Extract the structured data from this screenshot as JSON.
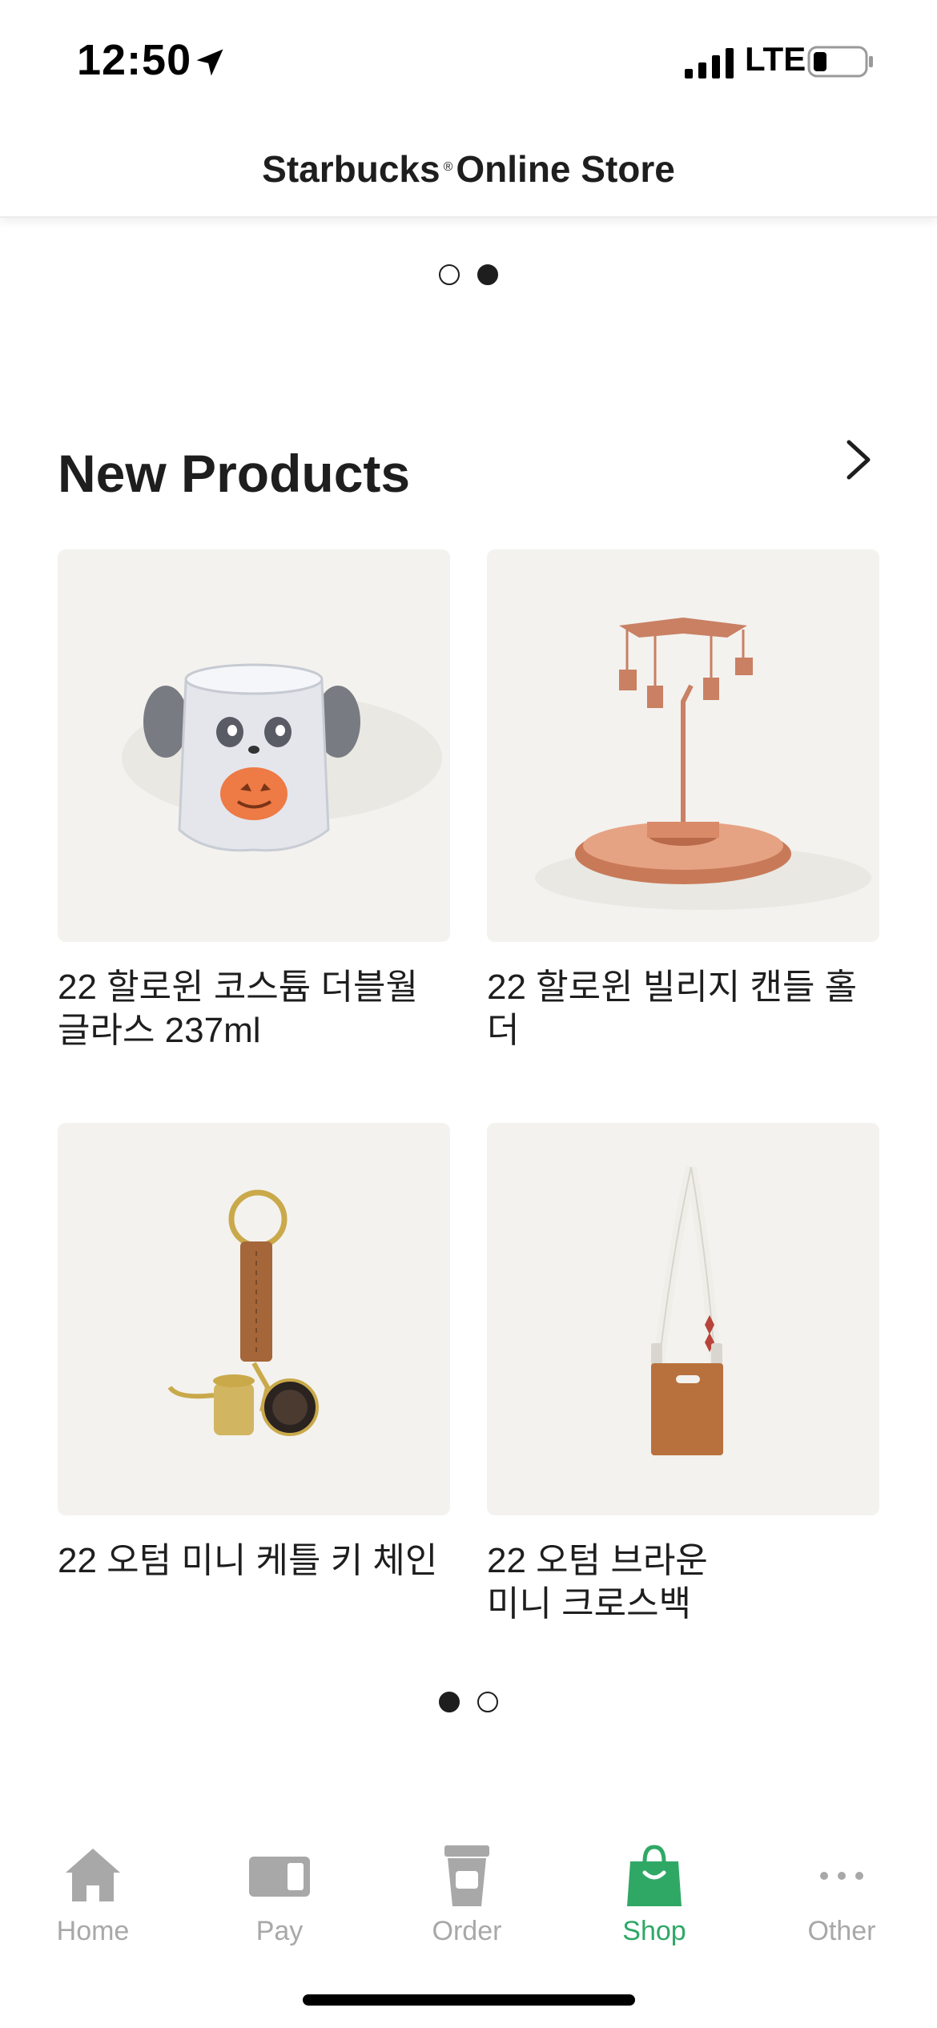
{
  "status_bar": {
    "time": "12:50",
    "network": "LTE"
  },
  "header": {
    "title_left": "Starbucks",
    "registered_mark": "®",
    "title_right": "Online Store"
  },
  "top_carousel": {
    "pages": 2,
    "active_index": 1
  },
  "new_products": {
    "title": "New Products",
    "items": [
      {
        "name": "22 할로윈 코스튬 더블월\n글라스 237ml",
        "image": "ghost-glass-image"
      },
      {
        "name": "22 할로윈 빌리지 캔들 홀더",
        "image": "candle-holder-image"
      },
      {
        "name": "22 오텀 미니 케틀 키 체인",
        "image": "kettle-keychain-image"
      },
      {
        "name": "22 오텀 브라운\n미니 크로스백",
        "image": "mini-crossbag-image"
      }
    ],
    "carousel": {
      "pages": 2,
      "active_index": 0
    }
  },
  "tab_bar": {
    "tabs": [
      {
        "label": "Home",
        "icon": "home-icon",
        "active": false
      },
      {
        "label": "Pay",
        "icon": "card-icon",
        "active": false
      },
      {
        "label": "Order",
        "icon": "cup-icon",
        "active": false
      },
      {
        "label": "Shop",
        "icon": "shopping-bag-icon",
        "active": true
      },
      {
        "label": "Other",
        "icon": "more-dots-icon",
        "active": false
      }
    ]
  },
  "colors": {
    "accent": "#2fa866",
    "inactive": "#a8a8a8",
    "text": "#1e1e1e",
    "card_bg": "#f3f2ee"
  }
}
